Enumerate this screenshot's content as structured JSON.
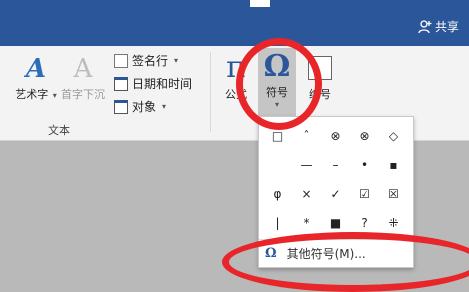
{
  "titlebar": {
    "share_label": "共享"
  },
  "ribbon": {
    "wordart": {
      "label": "艺术字",
      "glyph": "A"
    },
    "dropcap": {
      "label": "首字下沉",
      "glyph": "A"
    },
    "signature_line": {
      "label": "签名行"
    },
    "date_time": {
      "label": "日期和时间"
    },
    "object": {
      "label": "对象"
    },
    "text_group_label": "文本",
    "equation": {
      "label": "公式",
      "glyph": "π"
    },
    "symbol": {
      "label": "符号",
      "glyph": "Ω"
    },
    "number": {
      "label": "编号"
    }
  },
  "symbol_menu": {
    "symbols": [
      "□",
      "ˆ",
      "⊗",
      "⊗",
      "◇",
      "",
      "—",
      "–",
      "•",
      "▪",
      "φ",
      "×",
      "✓",
      "☑",
      "☒",
      "|",
      "*",
      "■",
      "?",
      "⁜"
    ],
    "more_symbols_icon": "Ω",
    "more_symbols_label": "其他符号(M)..."
  },
  "colors": {
    "title_bar": "#2b579a",
    "annotation": "#e8262a",
    "accent": "#2b579a"
  }
}
